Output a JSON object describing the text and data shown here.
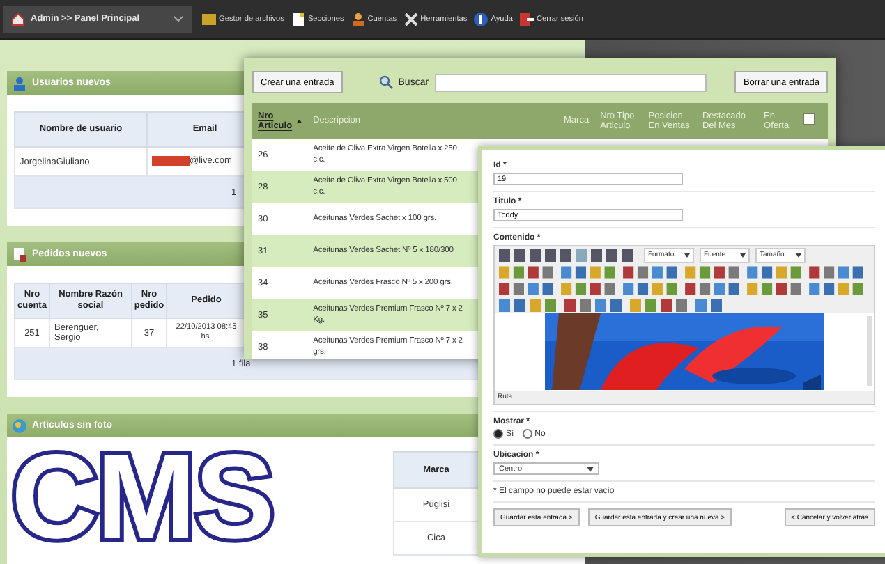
{
  "top_bar": {
    "breadcrumb": "Admin >> Panel Principal",
    "menu": [
      {
        "label": "Gestor de archivos",
        "kind": "folder"
      },
      {
        "label": "Secciones",
        "kind": "note"
      },
      {
        "label": "Cuentas",
        "kind": "users"
      },
      {
        "label": "Herramientas",
        "kind": "tools"
      },
      {
        "label": "Ayuda",
        "kind": "help"
      },
      {
        "label": "Cerrar sesión",
        "kind": "logout"
      }
    ]
  },
  "dashboard": {
    "usuarios": {
      "title": "Usuarios nuevos",
      "columns": [
        "Nombre de usuario",
        "Email"
      ],
      "rows": [
        [
          "JorgelinaGiuliano",
          "@live.com"
        ]
      ],
      "footer": "1"
    },
    "pedidos": {
      "title": "Pedidos nuevos",
      "columns": [
        "Nro cuenta",
        "Nombre Razón social",
        "Nro pedido",
        "Pedido"
      ],
      "rows": [
        [
          "251",
          "Berenguer, Sergio",
          "37",
          "22/10/2013 08:45 hs."
        ]
      ],
      "footer": "1 fila"
    },
    "articulos": {
      "title": "Articulos sin foto",
      "columns": [
        "Marca"
      ],
      "rows": [
        [
          "Puglisi"
        ],
        [
          "Cica"
        ]
      ]
    }
  },
  "articles_window": {
    "create_button": "Crear una entrada",
    "search_label": "Buscar",
    "delete_button": "Borrar una entrada",
    "select_all_checked": false,
    "columns": [
      "Nro Articulo",
      "Descripcion",
      "Marca",
      "Nro Tipo Articulo",
      "Posicion En Ventas",
      "Destacado Del Mes",
      "En Oferta"
    ],
    "rows": [
      {
        "id": "26",
        "description": "Aceite de Oliva Extra Virgen Botella x 250\nc.c."
      },
      {
        "id": "28",
        "description": "Aceite de Oliva Extra Virgen Botella x 500\nc.c."
      },
      {
        "id": "30",
        "description": "Aceitunas Verdes Sachet x 100 grs."
      },
      {
        "id": "31",
        "description": "Aceitunas Verdes Sachet Nº 5 x 180/300"
      },
      {
        "id": "34",
        "description": "Aceitunas Verdes Frasco Nº 5 x 200 grs."
      },
      {
        "id": "35",
        "description": "Aceitunas Verdes Premium Frasco Nº 7 x 2\nKg."
      },
      {
        "id": "38",
        "description": "Aceitunas Verdes Premium Frasco Nº 7 x 2\ngrs."
      }
    ]
  },
  "edit_form": {
    "id_label": "Id *",
    "id_value": "19",
    "title_label": "Titulo *",
    "title_value": "Toddy",
    "content_label": "Contenido *",
    "editor_selects": [
      "Formato",
      "Fuente",
      "Tamaño"
    ],
    "editor_path": "Ruta",
    "show_label": "Mostrar *",
    "show_options": [
      {
        "label": "Sí",
        "selected": true
      },
      {
        "label": "No",
        "selected": false
      }
    ],
    "location_label": "Ubicacion *",
    "location_value": "Centro",
    "note": "* El campo no puede estar vacío",
    "buttons": [
      "Guardar esta entrada >",
      "Guardar esta entrada y crear una nueva >",
      "< Cancelar y volver atrás"
    ]
  },
  "overlay_title": "CMS"
}
